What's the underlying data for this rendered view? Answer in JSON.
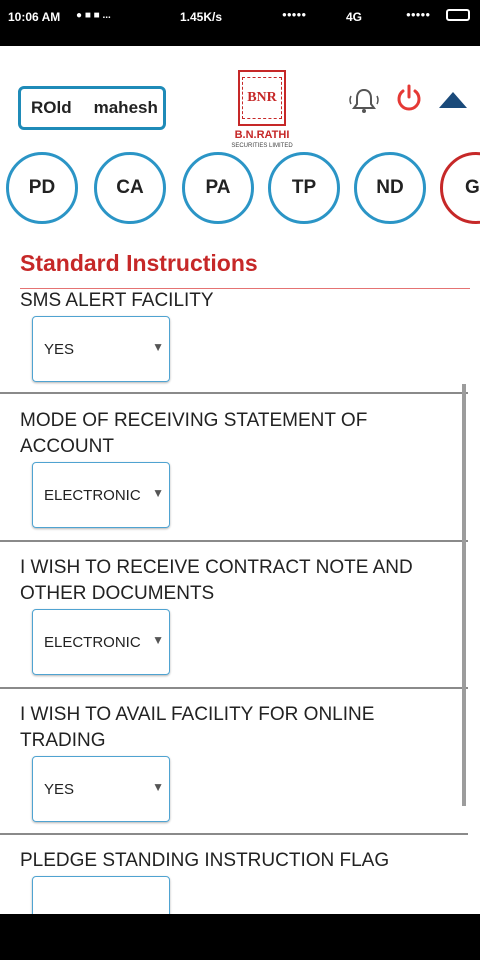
{
  "status": {
    "time": "10:06 AM",
    "left_icons": "● ■ ■ ...",
    "speed": "1.45K/s",
    "network": "4G",
    "dots_left": "●●●●●",
    "dots_right": "●●●●●"
  },
  "header": {
    "roid_label": "ROld",
    "user_name": "mahesh",
    "logo_mark": "BNR",
    "logo_name": "B.N.RATHI",
    "logo_tagline": "SECURITIES LIMITED"
  },
  "tabs": [
    {
      "label": "PD"
    },
    {
      "label": "CA"
    },
    {
      "label": "PA"
    },
    {
      "label": "TP"
    },
    {
      "label": "ND"
    },
    {
      "label": "G"
    }
  ],
  "section": {
    "title": "Standard Instructions"
  },
  "fields": [
    {
      "label": "SMS ALERT FACILITY",
      "value": "YES"
    },
    {
      "label": "MODE OF RECEIVING STATEMENT OF ACCOUNT",
      "value": "ELECTRONIC"
    },
    {
      "label": "I WISH TO RECEIVE CONTRACT NOTE AND OTHER DOCUMENTS",
      "value": "ELECTRONIC"
    },
    {
      "label": "I WISH TO AVAIL FACILITY FOR ONLINE TRADING",
      "value": "YES"
    },
    {
      "label": "PLEDGE STANDING INSTRUCTION FLAG",
      "value": ""
    }
  ],
  "colors": {
    "accent_red": "#c62828",
    "tab_blue": "#2b95c6",
    "field_border": "#4fa3d1"
  }
}
